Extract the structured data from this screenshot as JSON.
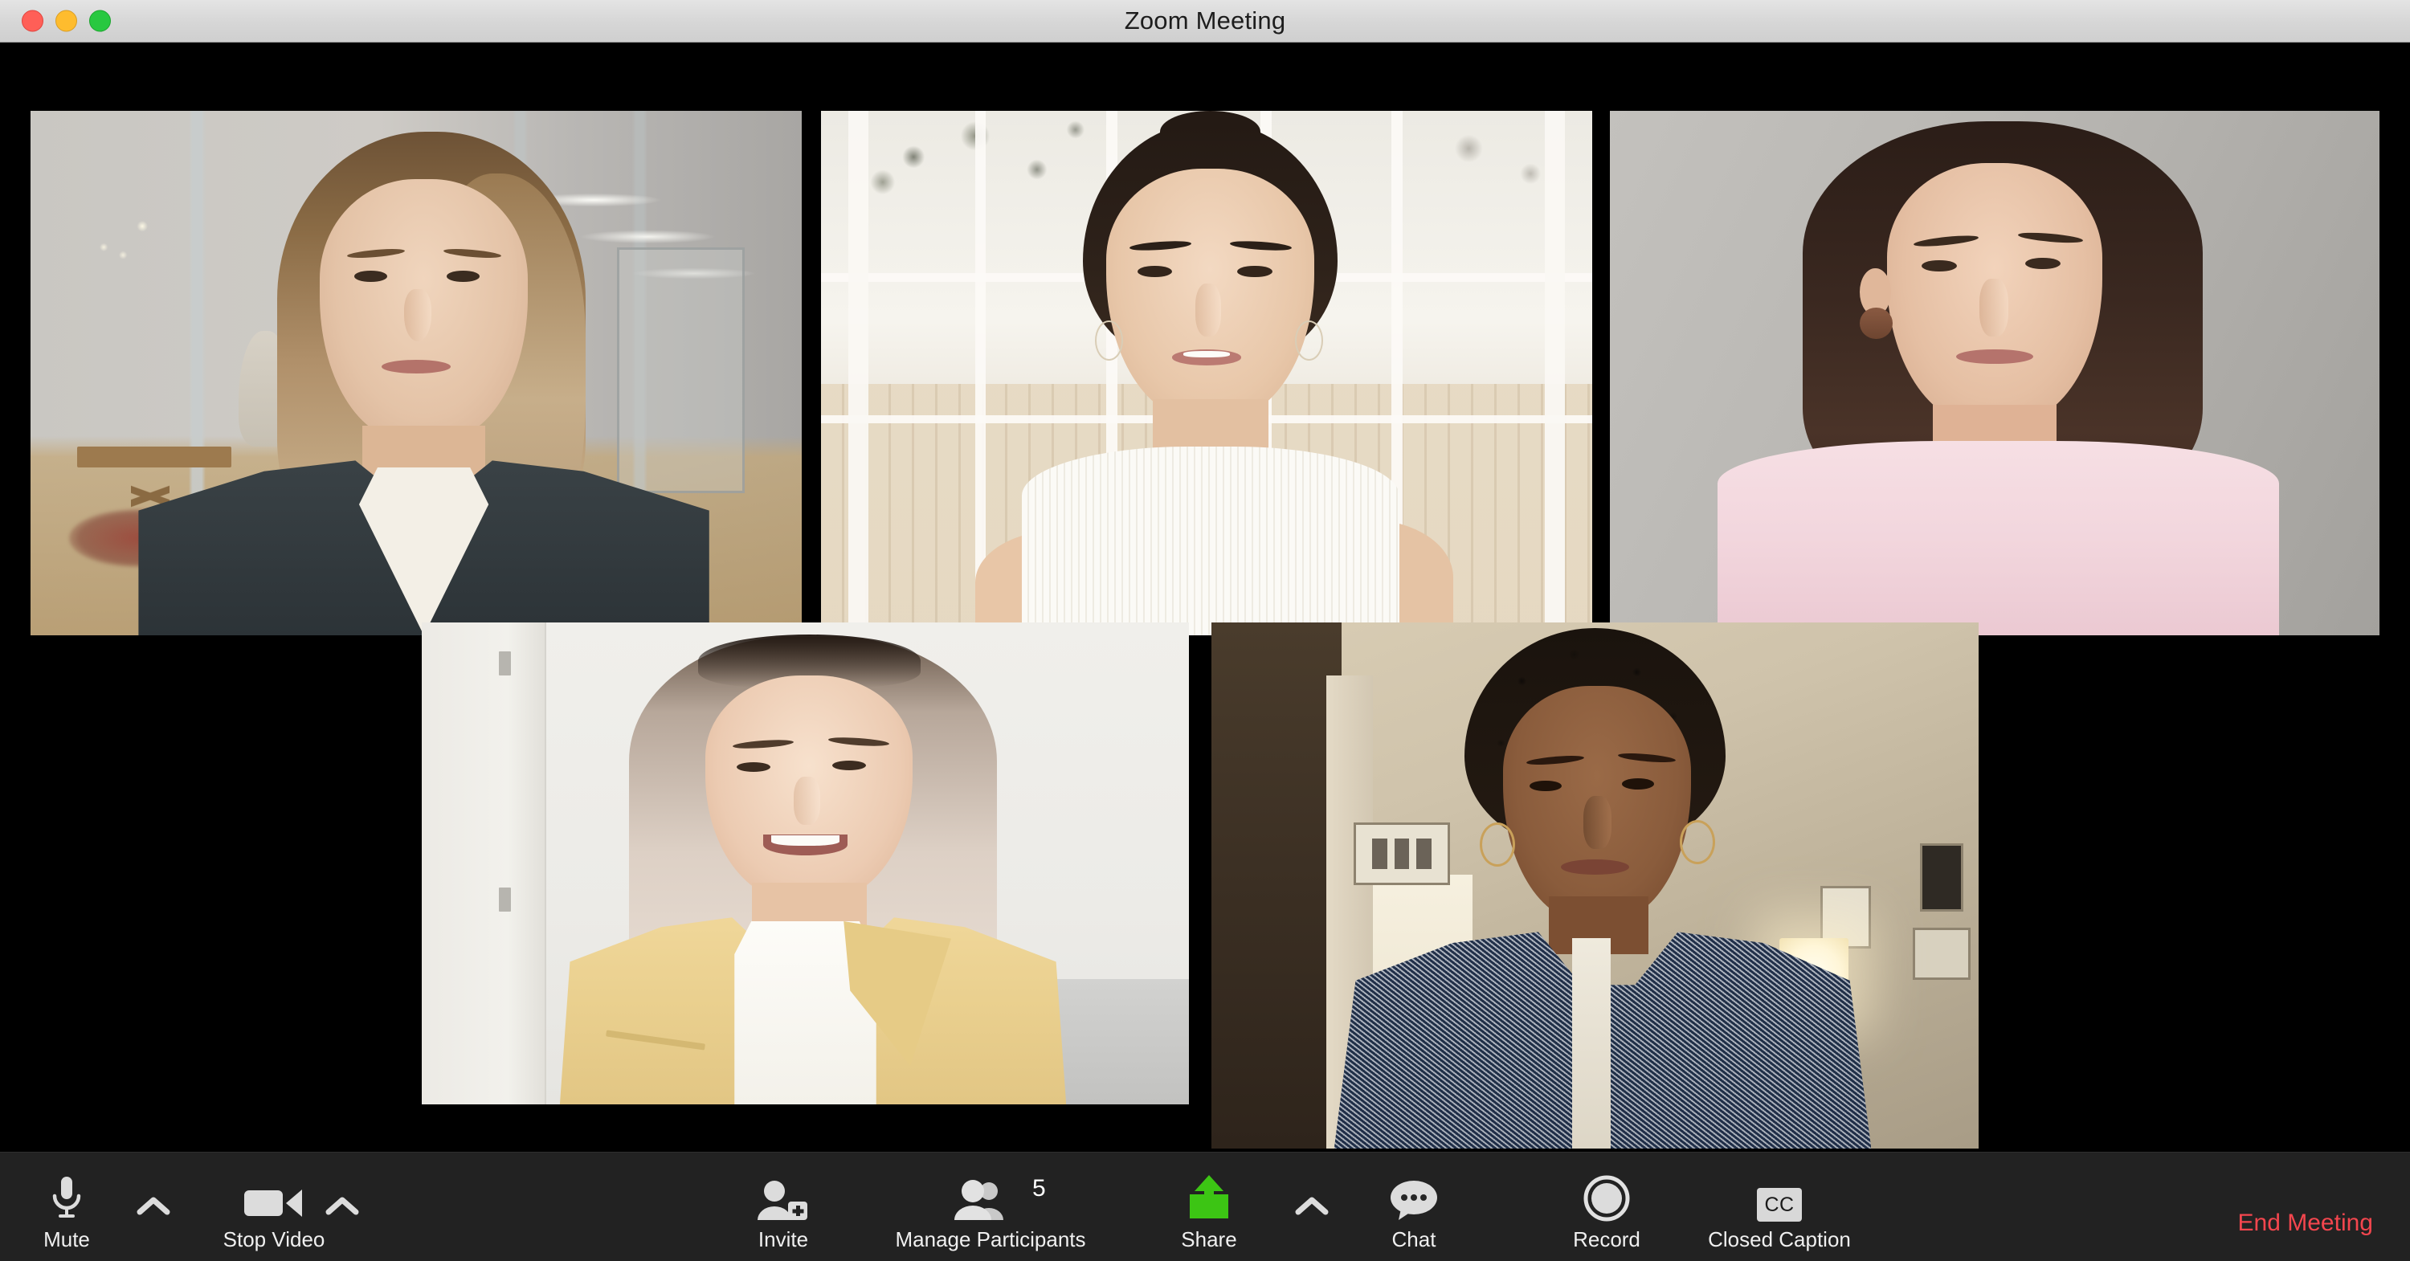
{
  "window": {
    "title": "Zoom Meeting",
    "controls": {
      "close": "close-window",
      "minimize": "minimize-window",
      "maximize": "maximize-window"
    }
  },
  "stage": {
    "layout": "gallery-grid",
    "rows": 2,
    "participants": [
      {
        "index": 1,
        "position": "row1-col1",
        "video_on": true
      },
      {
        "index": 2,
        "position": "row1-col2",
        "video_on": true
      },
      {
        "index": 3,
        "position": "row1-col3",
        "video_on": true
      },
      {
        "index": 4,
        "position": "row2-col1",
        "video_on": true
      },
      {
        "index": 5,
        "position": "row2-col2",
        "video_on": true
      }
    ]
  },
  "toolbar": {
    "mute": {
      "label": "Mute",
      "icon": "microphone-icon",
      "has_chevron": true
    },
    "video": {
      "label": "Stop Video",
      "icon": "video-camera-icon",
      "has_chevron": true
    },
    "invite": {
      "label": "Invite",
      "icon": "person-add-icon"
    },
    "participants": {
      "label": "Manage Participants",
      "icon": "people-icon",
      "count": "5"
    },
    "share": {
      "label": "Share",
      "icon": "share-screen-icon",
      "has_chevron": true,
      "color": "#3cc514"
    },
    "chat": {
      "label": "Chat",
      "icon": "chat-bubble-icon"
    },
    "record": {
      "label": "Record",
      "icon": "record-circle-icon"
    },
    "closed_caption": {
      "label": "Closed Caption",
      "icon": "closed-caption-icon",
      "badge_text": "CC"
    },
    "end_meeting": {
      "label": "End Meeting",
      "color": "#f4464e"
    }
  }
}
